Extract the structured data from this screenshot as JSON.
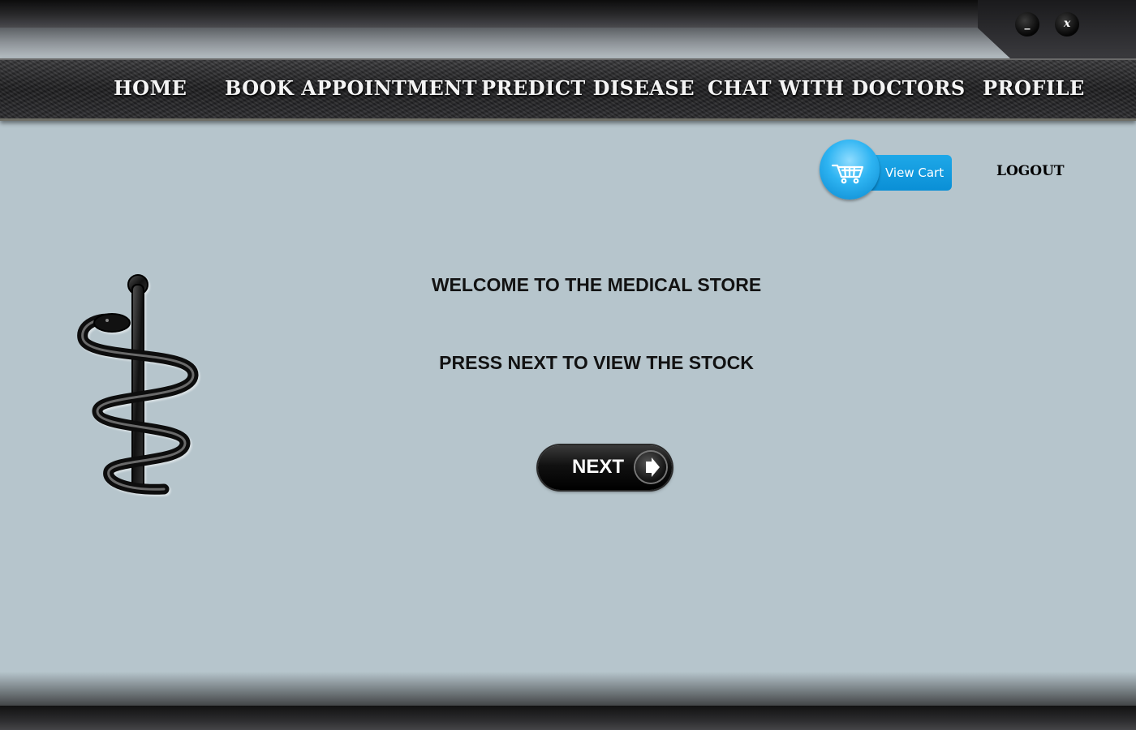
{
  "window": {
    "minimize_label": "_",
    "close_label": "x"
  },
  "nav": {
    "items": [
      {
        "label": "Home"
      },
      {
        "label": "Book Appointment"
      },
      {
        "label": "Predict Disease"
      },
      {
        "label": "Chat With Doctors"
      },
      {
        "label": "Profile"
      }
    ]
  },
  "cart": {
    "label": "View Cart",
    "icon": "shopping-cart-icon"
  },
  "logout_label": "LOGOUT",
  "main": {
    "welcome": "WELCOME TO THE MEDICAL STORE",
    "instruction": "PRESS NEXT TO VIEW THE STOCK",
    "next_label": "NEXT"
  },
  "logo_icon": "rod-of-asclepius-icon",
  "colors": {
    "background": "#b6c5cc",
    "cart_accent": "#1ea8e8",
    "nav_text": "#f4f4f4"
  }
}
